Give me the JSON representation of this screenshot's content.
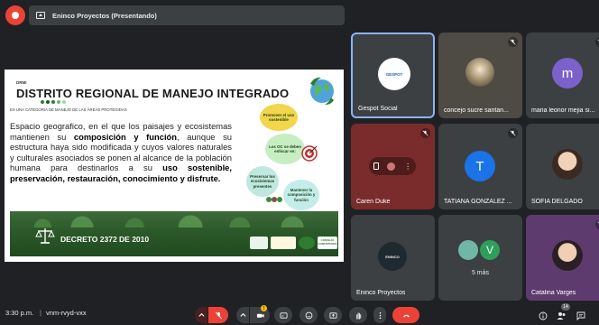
{
  "window": {
    "presenting_label": "Eninco Proyectos (Presentando)"
  },
  "slide": {
    "small_caption": "DRMI",
    "title": "DISTRITO REGIONAL DE MANEJO INTEGRADO",
    "subtitle": "ES UNA CATEGORIA DE MANEJO DE LAS ÁREAS PROTEGIDAS",
    "body_plain_1": "Espacio geografico, en el que los paisajes y ecosistemas mantienen su ",
    "body_bold_1": "composición y función",
    "body_plain_2": ", aunque su estructura haya sido modificada y cuyos valores naturales y culturales asociados se ponen al alcance de la población humana para destinarlos a su ",
    "body_bold_2": "uso sostenible, preservación, restauración, conocimiento y disfrute.",
    "bubble_1": "Promover el uso sostenible",
    "bubble_2": "Los OC se deben enfocar en:",
    "bubble_3": "Preservar los ecosistemas presentes",
    "bubble_4": "Mantener la composición y función",
    "decreto": "DECRETO 2372 DE 2010",
    "logo_text": "CONSEJO COMUNITARIO"
  },
  "participants": [
    {
      "name": "Gespot Social",
      "logo_text": "GESPOT"
    },
    {
      "name": "concejo sucre santan..."
    },
    {
      "name": "maria leonor mejia si...",
      "initial": "m"
    },
    {
      "name": "Caren Duke"
    },
    {
      "name": "TATIANA GONZALEZ ...",
      "initial": "T"
    },
    {
      "name": "SOFIA DELGADO"
    },
    {
      "name": "Eninco Proyectos",
      "logo_text": "ENINCO"
    },
    {
      "name": "5 más",
      "initial": "V"
    },
    {
      "name": "Catalina Varges"
    }
  ],
  "bottom_bar": {
    "time": "3:30 p.m.",
    "separator": "|",
    "meeting_code": "vnm-rvyd-vxx",
    "people_count": "14",
    "camera_badge": "!"
  },
  "colors": {
    "background": "#202124",
    "end_call": "#ea4335",
    "active_tile_border": "#8ab4f8"
  },
  "icons": [
    "present-icon",
    "mic-off-icon",
    "camera-icon",
    "captions-icon",
    "emoji-icon",
    "present-screen-icon",
    "raise-hand-icon",
    "more-vert-icon",
    "end-call-icon",
    "info-icon",
    "people-icon",
    "chat-icon"
  ]
}
